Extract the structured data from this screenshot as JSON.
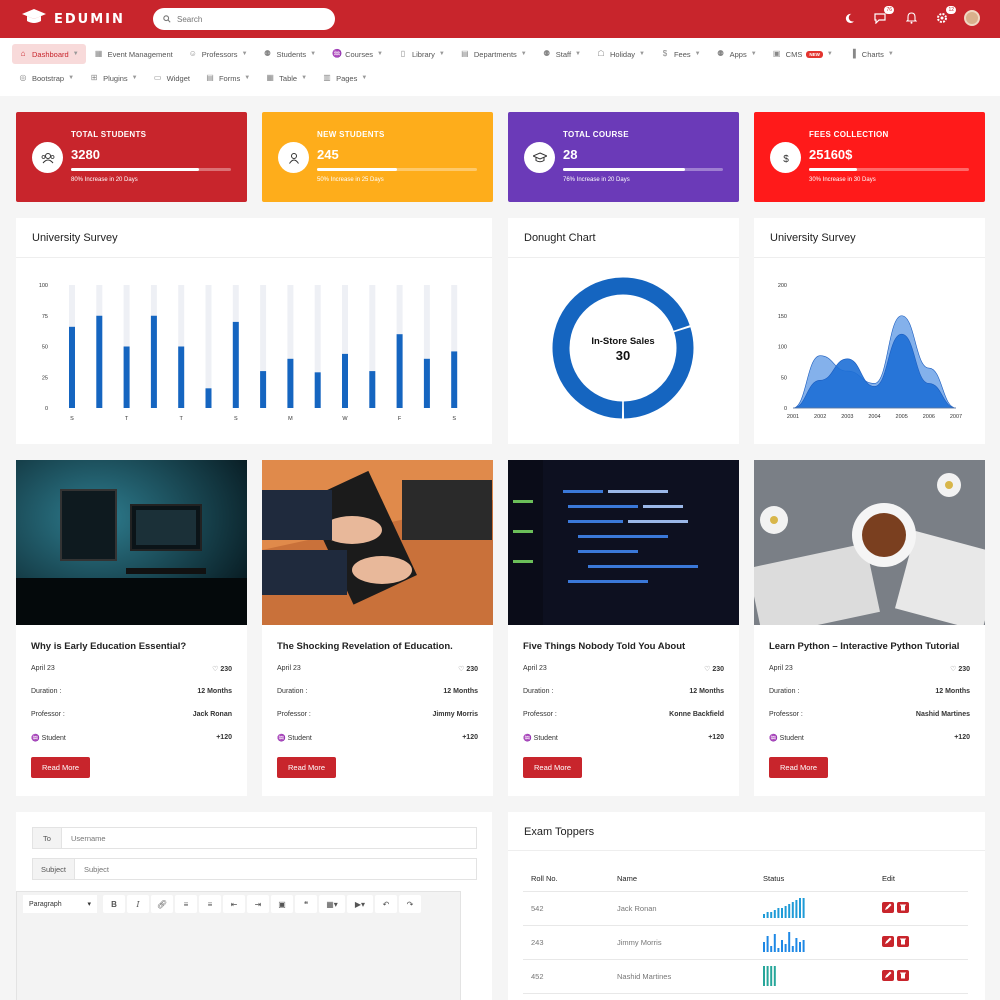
{
  "brand": {
    "name": "EDUMIN"
  },
  "search": {
    "placeholder": "Search"
  },
  "top_icons": {
    "chat_badge": "76",
    "gear_badge": "12"
  },
  "nav": {
    "row1": [
      {
        "label": "Dashboard",
        "icon": "home-icon",
        "caret": true,
        "active": true
      },
      {
        "label": "Event Management",
        "icon": "calendar-icon",
        "caret": false
      },
      {
        "label": "Professors",
        "icon": "user-icon",
        "caret": true
      },
      {
        "label": "Students",
        "icon": "users-icon",
        "caret": true
      },
      {
        "label": "Courses",
        "icon": "graduation-cap-icon",
        "caret": true
      },
      {
        "label": "Library",
        "icon": "book-icon",
        "caret": true
      },
      {
        "label": "Departments",
        "icon": "building-icon",
        "caret": true
      },
      {
        "label": "Staff",
        "icon": "users-icon",
        "caret": true
      },
      {
        "label": "Holiday",
        "icon": "holiday-icon",
        "caret": true
      },
      {
        "label": "Fees",
        "icon": "dollar-icon",
        "caret": true
      },
      {
        "label": "Apps",
        "icon": "apps-icon",
        "caret": true
      },
      {
        "label": "CMS",
        "icon": "cms-icon",
        "caret": true,
        "badge": "NEW"
      },
      {
        "label": "Charts",
        "icon": "chart-icon",
        "caret": true
      }
    ],
    "row2": [
      {
        "label": "Bootstrap",
        "icon": "bootstrap-icon",
        "caret": true
      },
      {
        "label": "Plugins",
        "icon": "plugin-icon",
        "caret": true
      },
      {
        "label": "Widget",
        "icon": "widget-icon",
        "caret": false
      },
      {
        "label": "Forms",
        "icon": "form-icon",
        "caret": true
      },
      {
        "label": "Table",
        "icon": "table-icon",
        "caret": true
      },
      {
        "label": "Pages",
        "icon": "pages-icon",
        "caret": true
      }
    ]
  },
  "stats": [
    {
      "title": "TOTAL STUDENTS",
      "value": "3280",
      "sub": "80% Increase in 20 Days",
      "progress": 0.8,
      "color": "#c8252c",
      "icon": "users-icon"
    },
    {
      "title": "NEW STUDENTS",
      "value": "245",
      "sub": "50% Increase in 25 Days",
      "progress": 0.5,
      "color": "#fead1b",
      "icon": "user-icon"
    },
    {
      "title": "TOTAL COURSE",
      "value": "28",
      "sub": "76% Increase in 20 Days",
      "progress": 0.76,
      "color": "#6b3ab8",
      "icon": "graduation-cap-icon"
    },
    {
      "title": "FEES COLLECTION",
      "value": "25160$",
      "sub": "30% Increase in 30 Days",
      "progress": 0.3,
      "color": "#ff1a1a",
      "icon": "dollar-icon"
    }
  ],
  "panels": {
    "survey_title": "University Survey",
    "donut_title": "Donught Chart",
    "area_title": "University Survey"
  },
  "chart_data": [
    {
      "type": "bar",
      "title": "University Survey",
      "categories": [
        "S",
        "",
        "T",
        "",
        "T",
        "",
        "S",
        "",
        "M",
        "",
        "W",
        "",
        "F",
        "",
        "S"
      ],
      "values": [
        66,
        75,
        50,
        75,
        50,
        16,
        70,
        30,
        40,
        29,
        44,
        30,
        60,
        40,
        46
      ],
      "ylim": [
        0,
        100
      ],
      "yticks": [
        0,
        25,
        50,
        75,
        100
      ],
      "color": "#1565c0",
      "track_color": "#eef0f5"
    },
    {
      "type": "pie",
      "title": "Donught Chart",
      "center_label": "In-Store Sales",
      "center_value": "30",
      "segments": [
        {
          "value": 70
        },
        {
          "value": 30
        }
      ],
      "color": "#1565c0"
    },
    {
      "type": "area",
      "title": "University Survey",
      "x": [
        "2001",
        "2002",
        "2003",
        "2004",
        "2005",
        "2006",
        "2007"
      ],
      "series": [
        {
          "values": [
            0,
            85,
            60,
            40,
            150,
            65,
            0
          ],
          "color": "#6fa3e8"
        },
        {
          "values": [
            0,
            45,
            80,
            35,
            120,
            40,
            0
          ],
          "color": "#1d6fd6"
        }
      ],
      "ylim": [
        0,
        200
      ],
      "yticks": [
        0,
        50,
        100,
        150,
        200
      ]
    }
  ],
  "blogs": [
    {
      "title": "Why is Early Education Essential?",
      "date": "April 23",
      "likes": "230",
      "duration_label": "Duration :",
      "duration": "12 Months",
      "professor_label": "Professor :",
      "professor": "Jack Ronan",
      "student_label": "Student",
      "students": "+120",
      "button": "Read More"
    },
    {
      "title": "The Shocking Revelation of Education.",
      "date": "April 23",
      "likes": "230",
      "duration_label": "Duration :",
      "duration": "12 Months",
      "professor_label": "Professor :",
      "professor": "Jimmy Morris",
      "student_label": "Student",
      "students": "+120",
      "button": "Read More"
    },
    {
      "title": "Five Things Nobody Told You About",
      "date": "April 23",
      "likes": "230",
      "duration_label": "Duration :",
      "duration": "12 Months",
      "professor_label": "Professor :",
      "professor": "Konne Backfield",
      "student_label": "Student",
      "students": "+120",
      "button": "Read More"
    },
    {
      "title": "Learn Python – Interactive Python Tutorial",
      "date": "April 23",
      "likes": "230",
      "duration_label": "Duration :",
      "duration": "12 Months",
      "professor_label": "Professor :",
      "professor": "Nashid Martines",
      "student_label": "Student",
      "students": "+120",
      "button": "Read More"
    }
  ],
  "compose": {
    "to_label": "To",
    "to_placeholder": "Username",
    "subject_label": "Subject",
    "subject_placeholder": "Subject",
    "format_select": "Paragraph"
  },
  "exam": {
    "title": "Exam Toppers",
    "columns": [
      "Roll No.",
      "Name",
      "Status",
      "Edit"
    ],
    "rows": [
      {
        "roll": "542",
        "name": "Jack Ronan",
        "spark": [
          2,
          3,
          3,
          4,
          5,
          5,
          6,
          7,
          8,
          9,
          10,
          10
        ],
        "color": "#1e9bd7"
      },
      {
        "roll": "243",
        "name": "Jimmy Morris",
        "spark": [
          5,
          8,
          3,
          9,
          2,
          6,
          4,
          10,
          3,
          7,
          5,
          6
        ],
        "color": "#1e88e5"
      },
      {
        "roll": "452",
        "name": "Nashid Martines",
        "spark": [
          10,
          10,
          10,
          10
        ],
        "color": "#26a69a"
      }
    ]
  }
}
